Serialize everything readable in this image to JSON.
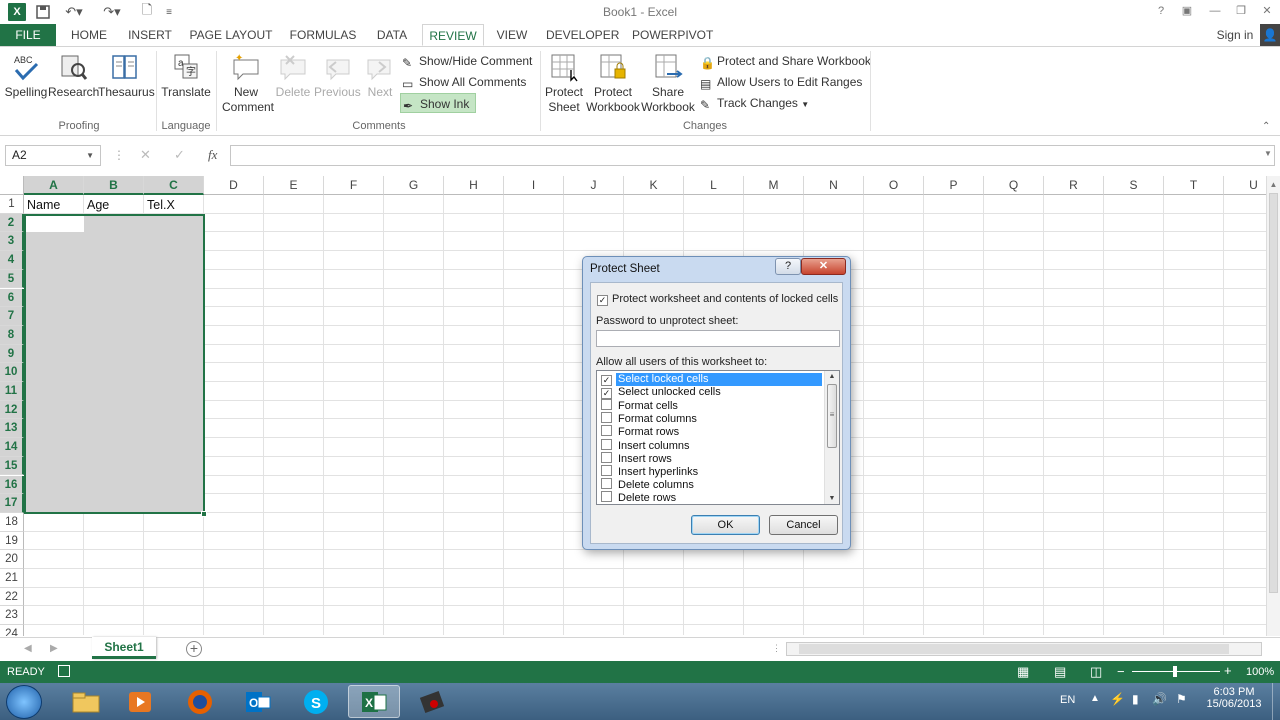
{
  "window": {
    "title": "Book1 - Excel",
    "sign_in": "Sign in"
  },
  "tabs": [
    "FILE",
    "HOME",
    "INSERT",
    "PAGE LAYOUT",
    "FORMULAS",
    "DATA",
    "REVIEW",
    "VIEW",
    "DEVELOPER",
    "POWERPIVOT"
  ],
  "active_tab": "REVIEW",
  "ribbon": {
    "proofing": {
      "spelling": "Spelling",
      "research": "Research",
      "thesaurus": "Thesaurus",
      "group": "Proofing"
    },
    "language": {
      "translate": "Translate",
      "group": "Language"
    },
    "comments": {
      "new_comment_1": "New",
      "new_comment_2": "Comment",
      "delete": "Delete",
      "previous": "Previous",
      "next": "Next",
      "show_hide": "Show/Hide Comment",
      "show_all": "Show All Comments",
      "show_ink": "Show Ink",
      "group": "Comments"
    },
    "changes": {
      "protect_sheet_1": "Protect",
      "protect_sheet_2": "Sheet",
      "protect_workbook_1": "Protect",
      "protect_workbook_2": "Workbook",
      "share_workbook_1": "Share",
      "share_workbook_2": "Workbook",
      "protect_share": "Protect and Share Workbook",
      "allow_users": "Allow Users to Edit Ranges",
      "track_changes": "Track Changes",
      "group": "Changes"
    }
  },
  "formula_bar": {
    "name_box": "A2",
    "fx": "fx",
    "value": ""
  },
  "grid": {
    "columns": [
      "A",
      "B",
      "C",
      "D",
      "E",
      "F",
      "G",
      "H",
      "I",
      "J",
      "K",
      "L",
      "M",
      "N",
      "O",
      "P",
      "Q",
      "R",
      "S",
      "T",
      "U"
    ],
    "rows": [
      "1",
      "2",
      "3",
      "4",
      "5",
      "6",
      "7",
      "8",
      "9",
      "10",
      "11",
      "12",
      "13",
      "14",
      "15",
      "16",
      "17",
      "18",
      "19",
      "20",
      "21",
      "22",
      "23",
      "24"
    ],
    "cells": {
      "A1": "Name",
      "B1": "Age",
      "C1": "Tel.X"
    },
    "selection": "A2:C17"
  },
  "sheets": [
    "Sheet1"
  ],
  "status": {
    "ready": "READY",
    "zoom": "100%"
  },
  "dialog": {
    "title": "Protect Sheet",
    "protect_label": "Protect worksheet and contents of locked cells",
    "protect_checked": true,
    "password_label": "Password to unprotect sheet:",
    "password_value": "",
    "allow_label": "Allow all users of this worksheet to:",
    "options": [
      {
        "label": "Select locked cells",
        "checked": true
      },
      {
        "label": "Select unlocked cells",
        "checked": true
      },
      {
        "label": "Format cells",
        "checked": false
      },
      {
        "label": "Format columns",
        "checked": false
      },
      {
        "label": "Format rows",
        "checked": false
      },
      {
        "label": "Insert columns",
        "checked": false
      },
      {
        "label": "Insert rows",
        "checked": false
      },
      {
        "label": "Insert hyperlinks",
        "checked": false
      },
      {
        "label": "Delete columns",
        "checked": false
      },
      {
        "label": "Delete rows",
        "checked": false
      }
    ],
    "ok": "OK",
    "cancel": "Cancel"
  },
  "taskbar": {
    "lang": "EN",
    "time": "6:03 PM",
    "date": "15/06/2013"
  },
  "colors": {
    "excel_green": "#217346",
    "selection_fill": "#d3d3d3",
    "list_highlight": "#3399ff"
  }
}
